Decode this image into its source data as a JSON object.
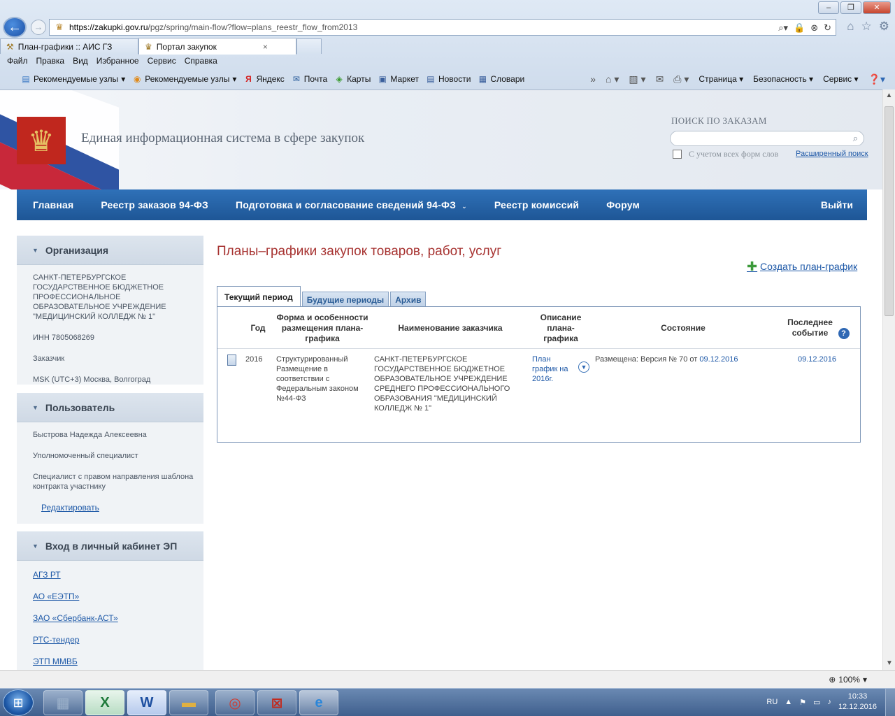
{
  "browser": {
    "url_domain": "https://zakupki.gov.ru",
    "url_rest": "/pgz/spring/main-flow?flow=plans_reestr_flow_from2013",
    "tabs": [
      {
        "label": "План-графики :: АИС ГЗ"
      },
      {
        "label": "Портал закупок"
      }
    ],
    "menu": [
      "Файл",
      "Правка",
      "Вид",
      "Избранное",
      "Сервис",
      "Справка"
    ],
    "favorites": [
      "Рекомендуемые узлы",
      "Рекомендуемые узлы",
      "Яндекс",
      "Почта",
      "Карты",
      "Маркет",
      "Новости",
      "Словари"
    ],
    "commands": [
      "Страница",
      "Безопасность",
      "Сервис"
    ],
    "zoom": "100%"
  },
  "header": {
    "site_title": "Единая информационная система в сфере закупок",
    "search_label": "ПОИСК ПО ЗАКАЗАМ",
    "search_placeholder": "",
    "checkbox_label": "С учетом всех форм слов",
    "advanced_search": "Расширенный поиск"
  },
  "nav": {
    "items": [
      "Главная",
      "Реестр заказов 94-ФЗ",
      "Подготовка и согласование сведений 94-ФЗ",
      "Реестр комиссий",
      "Форум"
    ],
    "logout": "Выйти"
  },
  "sidebar": {
    "org": {
      "title": "Организация",
      "name": "САНКТ-ПЕТЕРБУРГСКОЕ ГОСУДАРСТВЕННОЕ БЮДЖЕТНОЕ ПРОФЕССИОНАЛЬНОЕ ОБРАЗОВАТЕЛЬНОЕ УЧРЕЖДЕНИЕ \"МЕДИЦИНСКИЙ КОЛЛЕДЖ № 1\"",
      "inn": "ИНН 7805068269",
      "role": "Заказчик",
      "tz": "MSK (UTC+3) Москва, Волгоград"
    },
    "user": {
      "title": "Пользователь",
      "name": "Быстрова Надежда Алексеевна",
      "role1": "Уполномоченный специалист",
      "role2": "Специалист с правом направления шаблона контракта участнику",
      "edit": "Редактировать"
    },
    "ep": {
      "title": "Вход в личный кабинет ЭП",
      "links": [
        "АГЗ РТ",
        "АО «ЕЭТП»",
        "ЗАО «Сбербанк-АСТ»",
        "РТС-тендер",
        "ЭТП ММВБ"
      ]
    }
  },
  "main": {
    "title": "Планы–графики закупок товаров, работ, услуг",
    "create": "Создать план-график",
    "tabs": [
      "Текущий период",
      "Будущие периоды",
      "Архив"
    ],
    "columns": [
      "Год",
      "Форма и особенности размещения плана-графика",
      "Наименование заказчика",
      "Описание плана-графика",
      "Состояние",
      "Последнее событие"
    ],
    "rows": [
      {
        "year": "2016",
        "form": "Структурированный Размещение в соответствии с Федеральным законом №44-ФЗ",
        "customer": "САНКТ-ПЕТЕРБУРГСКОЕ ГОСУДАРСТВЕННОЕ БЮДЖЕТНОЕ ОБРАЗОВАТЕЛЬНОЕ УЧРЕЖДЕНИЕ СРЕДНЕГО ПРОФЕССИОНАЛЬНОГО ОБРАЗОВАНИЯ \"МЕДИЦИНСКИЙ КОЛЛЕДЖ № 1\"",
        "desc": "План график на 2016г.",
        "status_text": "Размещена: Версия №  70 от",
        "status_date": "09.12.2016",
        "last_event": "09.12.2016"
      }
    ]
  },
  "taskbar": {
    "lang": "RU",
    "time": "10:33",
    "date": "12.12.2016"
  }
}
